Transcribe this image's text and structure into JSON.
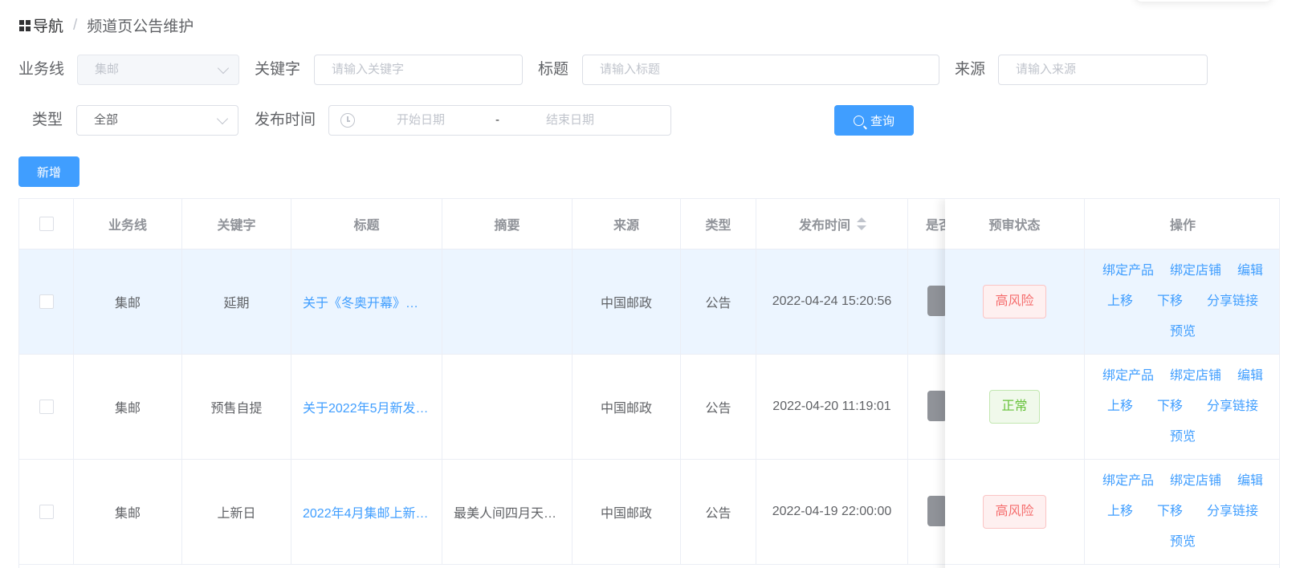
{
  "breadcrumb": {
    "home": "导航",
    "separator": "/",
    "current": "频道页公告维护"
  },
  "filters": {
    "business_line": {
      "label": "业务线",
      "value": "集邮"
    },
    "keyword": {
      "label": "关键字",
      "placeholder": "请输入关键字"
    },
    "title": {
      "label": "标题",
      "placeholder": "请输入标题"
    },
    "source": {
      "label": "来源",
      "placeholder": "请输入来源"
    },
    "type": {
      "label": "类型",
      "value": "全部"
    },
    "publish_time": {
      "label": "发布时间",
      "start_placeholder": "开始日期",
      "separator": "-",
      "end_placeholder": "结束日期"
    }
  },
  "buttons": {
    "search": "查询",
    "add": "新增"
  },
  "table": {
    "headers": [
      "业务线",
      "关键字",
      "标题",
      "摘要",
      "来源",
      "类型",
      "发布时间",
      "是否",
      "预审状态",
      "操作"
    ],
    "operations": {
      "bind_product": "绑定产品",
      "bind_shop": "绑定店铺",
      "edit": "编辑",
      "move_up": "上移",
      "move_down": "下移",
      "share_link": "分享链接",
      "preview": "预览"
    },
    "rows": [
      {
        "business_line": "集邮",
        "keyword": "延期",
        "title": "关于《冬奥开幕》…",
        "summary": "",
        "source": "中国邮政",
        "type": "公告",
        "publish_time": "2022-04-24 15:20:56",
        "review_status": "高风险"
      },
      {
        "business_line": "集邮",
        "keyword": "预售自提",
        "title": "关于2022年5月新发…",
        "summary": "",
        "source": "中国邮政",
        "type": "公告",
        "publish_time": "2022-04-20 11:19:01",
        "review_status": "正常"
      },
      {
        "business_line": "集邮",
        "keyword": "上新日",
        "title": "2022年4月集邮上新…",
        "summary": "最美人间四月天…",
        "source": "中国邮政",
        "type": "公告",
        "publish_time": "2022-04-19 22:00:00",
        "review_status": "高风险"
      }
    ]
  },
  "colors": {
    "primary": "#409eff",
    "danger": "#f56c6c",
    "success": "#67c23a",
    "highlight_row": "#ecf5ff"
  },
  "icons": {
    "nav": "grid-icon",
    "search": "search-icon",
    "clock": "clock-icon",
    "chevron": "chevron-down-icon"
  }
}
